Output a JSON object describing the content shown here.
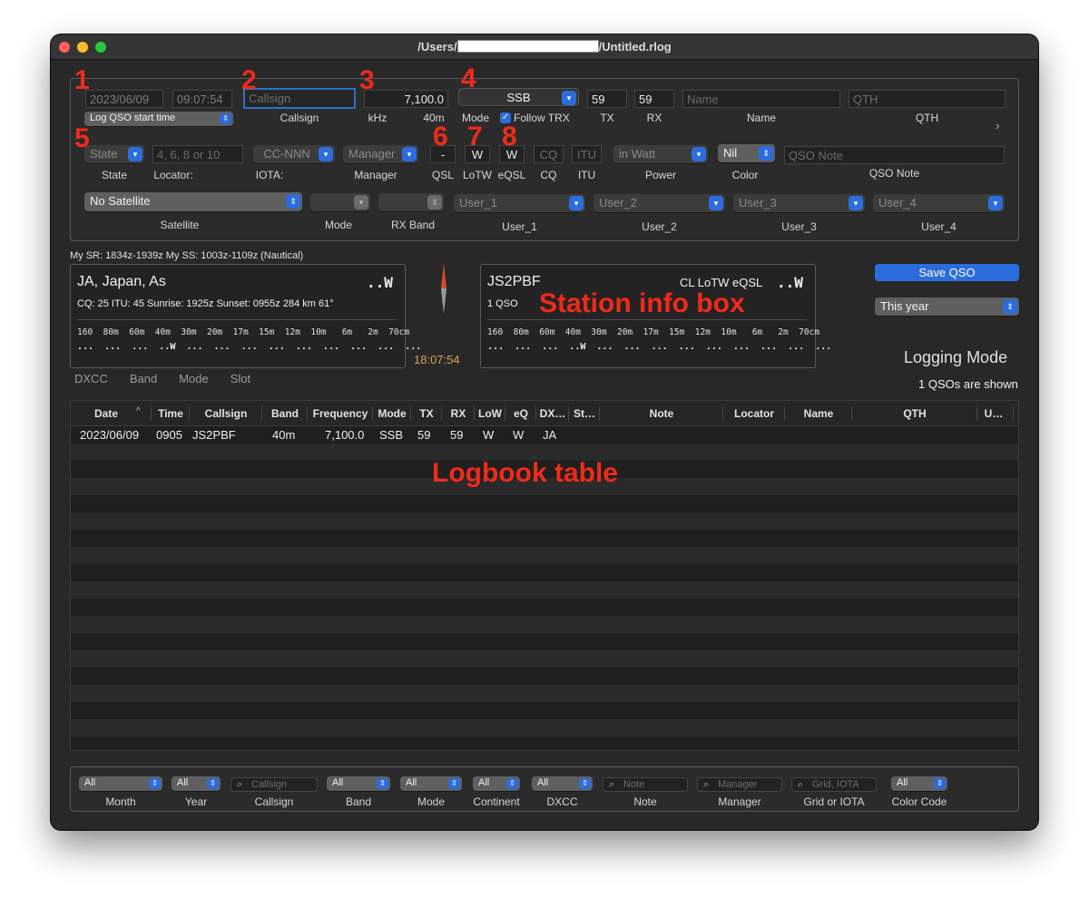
{
  "window": {
    "title_prefix": "/Users/",
    "title_suffix": "/Untitled.rlog"
  },
  "annotations": {
    "n1": "1",
    "n2": "2",
    "n3": "3",
    "n4": "4",
    "n5": "5",
    "n6": "6",
    "n7": "7",
    "n8": "8",
    "station_info": "Station info box",
    "logbook": "Logbook table"
  },
  "entry": {
    "date": "2023/06/09",
    "time": "09:07:54",
    "log_start_label": "Log QSO start time",
    "callsign_placeholder": "Callsign",
    "callsign_label": "Callsign",
    "frequency": "7,100.0",
    "khz_label": "kHz",
    "band": "40m",
    "mode": "SSB",
    "mode_label": "Mode",
    "follow_trx": "Follow TRX",
    "tx": "59",
    "tx_label": "TX",
    "rx": "59",
    "rx_label": "RX",
    "name_placeholder": "Name",
    "name_label": "Name",
    "qth_placeholder": "QTH",
    "qth_label": "QTH",
    "state_placeholder": "State",
    "state_label": "State",
    "locator_placeholder": "4, 6, 8 or 10",
    "locator_label": "Locator:",
    "iota_placeholder": "CC-NNN",
    "iota_label": "IOTA:",
    "manager_placeholder": "Manager",
    "manager_label": "Manager",
    "qsl": "-",
    "qsl_label": "QSL",
    "lotw": "W",
    "lotw_label": "LoTW",
    "eqsl": "W",
    "eqsl_label": "eQSL",
    "cq_placeholder": "CQ",
    "cq_label": "CQ",
    "itu_placeholder": "ITU",
    "itu_label": "ITU",
    "power_placeholder": "in Watt",
    "power_label": "Power",
    "color": "Nil",
    "color_label": "Color",
    "note_placeholder": "QSO Note",
    "note_label": "QSO Note",
    "satellite": "No Satellite",
    "satellite_label": "Satellite",
    "sat_mode_label": "Mode",
    "rx_band_label": "RX Band",
    "user1_placeholder": "User_1",
    "user1_label": "User_1",
    "user2_placeholder": "User_2",
    "user2_label": "User_2",
    "user3_placeholder": "User_3",
    "user3_label": "User_3",
    "user4_placeholder": "User_4",
    "user4_label": "User_4"
  },
  "sunrise_line": "My SR: 1834z-1939z  My SS: 1003z-1109z (Nautical)",
  "dx_box": {
    "title": "JA, Japan, As",
    "indicator": "..W",
    "details": "CQ: 25  ITU: 45  Sunrise: 1925z  Sunset: 0955z  284 km  61°",
    "bands": "160  80m  60m  40m  30m  20m  17m  15m  12m  10m   6m   2m  70cm",
    "marks": "...  ...  ...  ..W  ...  ...  ...  ...  ...  ...  ...  ...  ..."
  },
  "clock": "18:07:54",
  "tabs": [
    "DXCC",
    "Band",
    "Mode",
    "Slot"
  ],
  "station_box": {
    "call": "JS2PBF",
    "flags": "CL LoTW eQSL",
    "indicator": "..W",
    "count": "1 QSO",
    "bands": "160  80m  60m  40m  30m  20m  17m  15m  12m  10m   6m   2m  70cm",
    "marks": "...  ...  ...  ..W  ...  ...  ...  ...  ...  ...  ...  ...  ..."
  },
  "save_button": "Save QSO",
  "period": "This year",
  "logging_mode": "Logging Mode",
  "qso_count": "1 QSOs are shown",
  "table": {
    "columns": [
      "Date",
      "Time",
      "Callsign",
      "Band",
      "Frequency",
      "Mode",
      "TX",
      "RX",
      "LoW",
      "eQ",
      "DX…",
      "St…",
      "Note",
      "Locator",
      "Name",
      "QTH",
      "U…"
    ],
    "sort_indicator": "^",
    "rows": [
      [
        "2023/06/09",
        "0905",
        "JS2PBF",
        "40m",
        "7,100.0",
        "SSB",
        "59",
        "59",
        "W",
        "W",
        "JA"
      ]
    ]
  },
  "filters": {
    "month": "All",
    "month_label": "Month",
    "year": "All",
    "year_label": "Year",
    "callsign_placeholder": "Callsign",
    "callsign_label": "Callsign",
    "band": "All",
    "band_label": "Band",
    "mode": "All",
    "mode_label": "Mode",
    "continent": "All",
    "continent_label": "Continent",
    "dxcc": "All",
    "dxcc_label": "DXCC",
    "note_placeholder": "Note",
    "note_label": "Note",
    "manager_placeholder": "Manager",
    "manager_label": "Manager",
    "grid_placeholder": "Grid, IOTA",
    "grid_label": "Grid or IOTA",
    "color_code": "All",
    "color_code_label": "Color Code"
  },
  "colors": {
    "accent": "#2c6ddd",
    "annotation": "#f02a1a",
    "clock": "#d9a05b"
  }
}
